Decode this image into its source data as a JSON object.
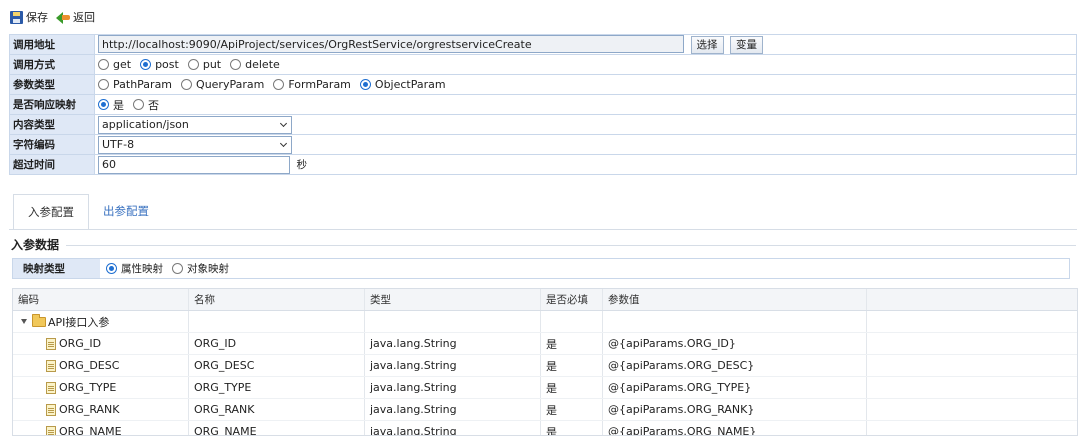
{
  "toolbar": {
    "save_label": "保存",
    "back_label": "返回"
  },
  "form": {
    "url_label": "调用地址",
    "url_value": "http://localhost:9090/ApiProject/services/OrgRestService/orgrestserviceCreate",
    "select_btn": "选择",
    "var_btn": "变量",
    "method_label": "调用方式",
    "methods": [
      "get",
      "post",
      "put",
      "delete"
    ],
    "method_selected": "post",
    "param_type_label": "参数类型",
    "param_types": [
      "PathParam",
      "QueryParam",
      "FormParam",
      "ObjectParam"
    ],
    "param_type_selected": "ObjectParam",
    "resp_map_label": "是否响应映射",
    "resp_map_options": [
      "是",
      "否"
    ],
    "resp_map_selected": "是",
    "content_type_label": "内容类型",
    "content_type_value": "application/json",
    "charset_label": "字符编码",
    "charset_value": "UTF-8",
    "timeout_label": "超过时间",
    "timeout_value": "60",
    "timeout_unit": "秒"
  },
  "tabs": {
    "active": "入参配置",
    "inactive": "出参配置"
  },
  "section": {
    "title": "入参数据",
    "map_type_label": "映射类型",
    "map_options": [
      "属性映射",
      "对象映射"
    ],
    "map_selected": "属性映射"
  },
  "grid": {
    "headers": [
      "编码",
      "名称",
      "类型",
      "是否必填",
      "参数值"
    ],
    "root": "API接口入参",
    "rows": [
      {
        "code": "ORG_ID",
        "name": "ORG_ID",
        "type": "java.lang.String",
        "required": "是",
        "value": "@{apiParams.ORG_ID}"
      },
      {
        "code": "ORG_DESC",
        "name": "ORG_DESC",
        "type": "java.lang.String",
        "required": "是",
        "value": "@{apiParams.ORG_DESC}"
      },
      {
        "code": "ORG_TYPE",
        "name": "ORG_TYPE",
        "type": "java.lang.String",
        "required": "是",
        "value": "@{apiParams.ORG_TYPE}"
      },
      {
        "code": "ORG_RANK",
        "name": "ORG_RANK",
        "type": "java.lang.String",
        "required": "是",
        "value": "@{apiParams.ORG_RANK}"
      },
      {
        "code": "ORG_NAME",
        "name": "ORG_NAME",
        "type": "java.lang.String",
        "required": "是",
        "value": "@{apiParams.ORG_NAME}"
      }
    ]
  },
  "colors": {
    "label_bg": "#dfe8f6",
    "border": "#c9d7ea",
    "accent": "#1f6fd1",
    "tab_link": "#3a72c0"
  }
}
